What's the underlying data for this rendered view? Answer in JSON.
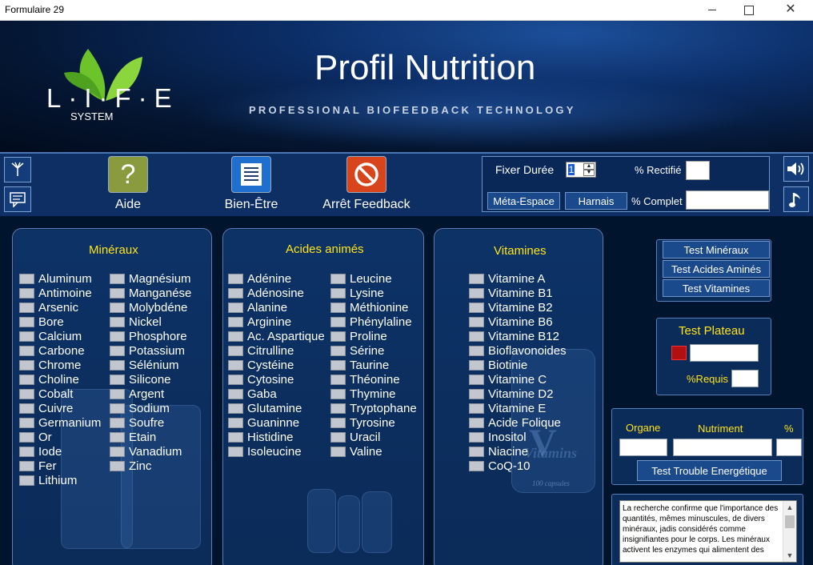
{
  "window": {
    "title": "Formulaire 29",
    "close_glyph": "✕"
  },
  "header": {
    "logo_text": "L·I·F·E",
    "logo_sub": "SYSTEM",
    "title": "Profil Nutrition",
    "tagline": "PROFESSIONAL BIOFEEDBACK TECHNOLOGY"
  },
  "toolbar": {
    "aide_label": "Aide",
    "aide_icon": "?",
    "bien_etre_label": "Bien-Être",
    "arret_label": "Arrêt Feedback",
    "fixer_duree_label": "Fixer Durée",
    "fixer_duree_value": "1",
    "rectifie_label": "% Rectifié",
    "meta_espace_label": "Méta-Espace",
    "harnais_label": "Harnais",
    "complet_label": "% Complet"
  },
  "mineraux": {
    "title": "Minéraux",
    "col1": [
      "Aluminum",
      "Antimoine",
      "Arsenic",
      "Bore",
      "Calcium",
      "Carbone",
      "Chrome",
      "Choline",
      "Cobalt",
      "Cuivre",
      "Germanium",
      "Or",
      "Iode",
      "Fer",
      "Lithium"
    ],
    "col2": [
      "Magnésium",
      "Manganése",
      "Molybdéne",
      "Nickel",
      "Phosphore",
      "Potassium",
      "Sélénium",
      "Silicone",
      "Argent",
      "Sodium",
      "Soufre",
      "Etain",
      "Vanadium",
      "Zinc"
    ]
  },
  "acides": {
    "title": "Acides animés",
    "col1": [
      "Adénine",
      "Adénosine",
      "Alanine",
      "Arginine",
      "Ac. Aspartique",
      "Citrulline",
      "Cystéine",
      "Cytosine",
      "Gaba",
      "Glutamine",
      "Guaninne",
      "Histidine",
      "Isoleucine"
    ],
    "col2": [
      "Leucine",
      "Lysine",
      "Méthionine",
      "Phénylaline",
      "Proline",
      "Sérine",
      "Taurine",
      "Théonine",
      "Thymine",
      "Tryptophane",
      "Tyrosine",
      "Uracil",
      "Valine"
    ]
  },
  "vitamines": {
    "title": "Vitamines",
    "items": [
      "Vitamine A",
      "Vitamine B1",
      "Vitamine B2",
      "Vitamine B6",
      "Vitamine B12",
      "Bioflavonoides",
      "Biotinie",
      "Vitamine C",
      "Vitamine D2",
      "Vitamine E",
      "Acide Folique",
      "Inositol",
      "Niacine",
      "CoQ-10"
    ],
    "bottle_label": "Vitamins",
    "bottle_sub": "100 capsules",
    "bottle_letter": "V"
  },
  "tests": {
    "mineraux": "Test Minéraux",
    "acides": "Test Acides Aminés",
    "vitamines": "Test Vitamines"
  },
  "plateau": {
    "title": "Test Plateau",
    "requis_label": "%Requis"
  },
  "organe": {
    "organe_label": "Organe",
    "nutriment_label": "Nutriment",
    "percent_label": "%",
    "trouble_button": "Test Trouble Energétique"
  },
  "description": {
    "text": "La recherche confirme que l'importance des quantités, mêmes minuscules, de divers minéraux, jadis considérés comme insignifiantes pour le corps.  Les minéraux activent les enzymes qui alimentent des"
  },
  "colors": {
    "accent_yellow": "#ffe41a",
    "panel_blue": "#0d3266",
    "plateau_red": "#b01010"
  }
}
